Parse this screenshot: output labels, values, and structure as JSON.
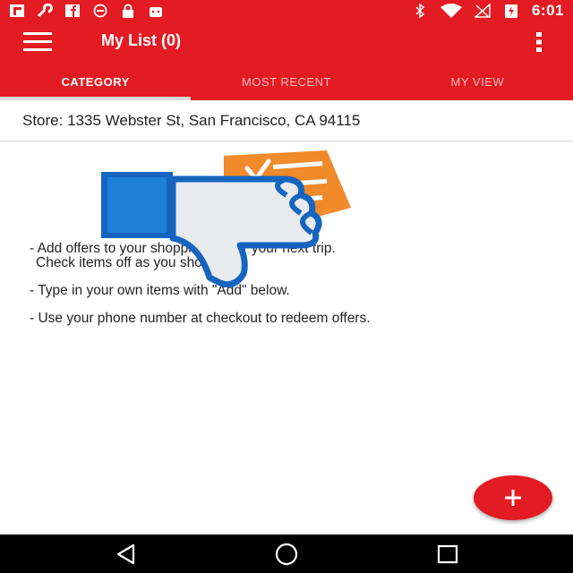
{
  "status_bar": {
    "time": "6:01",
    "icons": [
      "flipboard-icon",
      "wrench-icon",
      "facebook-icon",
      "dash-circle-icon",
      "lock-icon",
      "android-icon",
      "bluetooth-icon",
      "wifi-icon",
      "no-signal-icon",
      "battery-charging-icon"
    ]
  },
  "app_bar": {
    "title": "My List (0)",
    "menu_icon": "hamburger-menu-icon",
    "overflow_icon": "overflow-menu-icon"
  },
  "tabs": [
    {
      "label": "CATEGORY",
      "active": true
    },
    {
      "label": "MOST RECENT",
      "active": false
    },
    {
      "label": "MY VIEW",
      "active": false
    }
  ],
  "store": {
    "label": "Store: 1335 Webster St, San Francisco, CA 94115"
  },
  "tips": [
    {
      "line1": "- Add offers to your shopping list for your next trip.",
      "line2": "Check items off as you shop."
    },
    {
      "line1": "- Type in your own items with \"Add\" below."
    },
    {
      "line1": "- Use your phone number at checkout to redeem offers."
    }
  ],
  "overlay": {
    "icon": "thumbs-down-icon",
    "background_icon": "checklist-icon"
  },
  "fab": {
    "icon": "plus-icon"
  },
  "nav_bar": {
    "icons": [
      "back-icon",
      "home-icon",
      "recents-icon"
    ]
  },
  "colors": {
    "brand_red": "#e31b23",
    "thumb_blue": "#1565c0",
    "checklist_orange": "#f08a2b"
  }
}
